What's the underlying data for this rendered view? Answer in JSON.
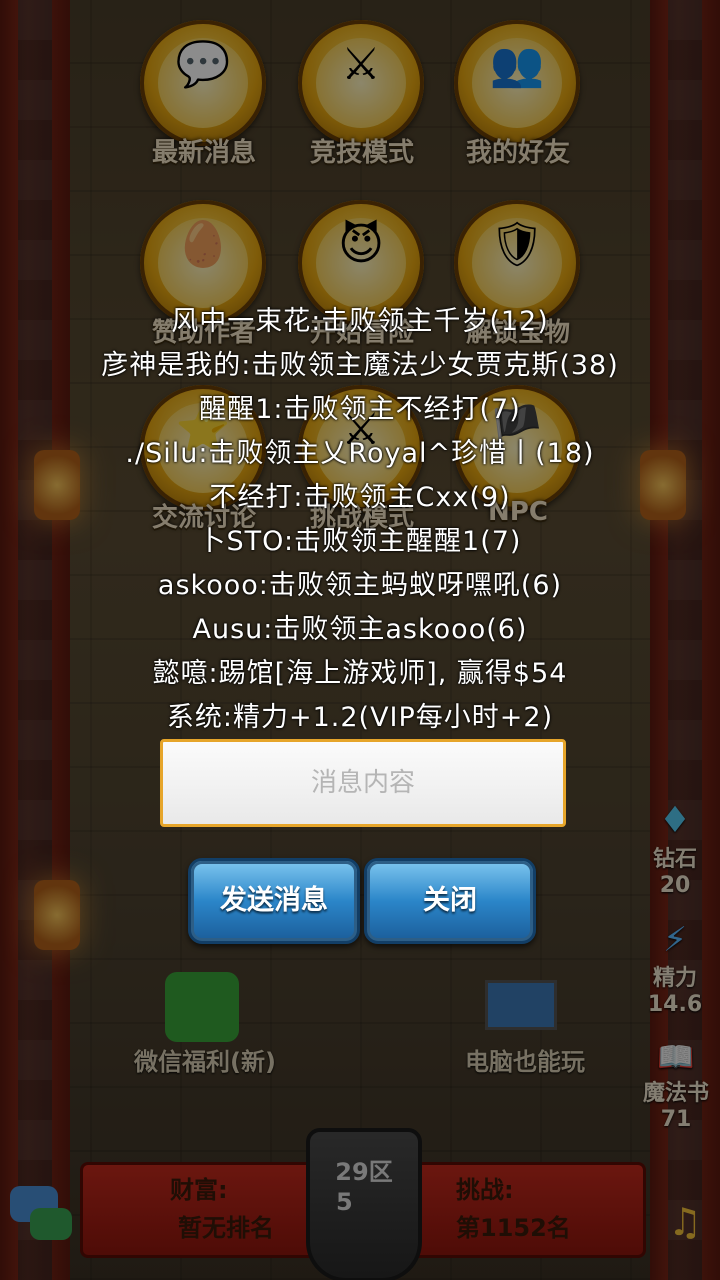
{
  "menu": [
    {
      "label": "最新消息",
      "icon": "message-book-icon",
      "glyph": "💬"
    },
    {
      "label": "竞技模式",
      "icon": "crossed-swords-vs-icon",
      "glyph": "⚔"
    },
    {
      "label": "我的好友",
      "icon": "friends-icon",
      "glyph": "👥"
    },
    {
      "label": "赞助作者",
      "icon": "egg-icon",
      "glyph": "🥚"
    },
    {
      "label": "开始冒险",
      "icon": "devil-icon",
      "glyph": "😈"
    },
    {
      "label": "解锁宝物",
      "icon": "armor-sword-icon",
      "glyph": "🛡"
    },
    {
      "label": "交流讨论",
      "icon": "discussion-shield-icon",
      "glyph": "⭐"
    },
    {
      "label": "挑战模式",
      "icon": "challenge-icon",
      "glyph": "⚔"
    },
    {
      "label": "NPC",
      "icon": "npc-icon",
      "glyph": "🏴"
    }
  ],
  "chat_lines": [
    "风中一束花:击败领主千岁(12)",
    "彦神是我的:击败领主魔法少女贾克斯(38)",
    "醒醒1:击败领主不经打(7)",
    "./Silu:击败领主乂Royal^珍惜丨(18)",
    "不经打:击败领主Cxx(9)",
    "卜STO:击败领主醒醒1(7)",
    "askooo:击败领主蚂蚁呀嘿吼(6)",
    "Ausu:击败领主askooo(6)",
    "懿噫:踢馆[海上游戏师], 赢得$54",
    "系统:精力+1.2(VIP每小时+2)"
  ],
  "message_input": {
    "placeholder": "消息内容",
    "value": ""
  },
  "buttons": {
    "send": "发送消息",
    "close": "关闭"
  },
  "bottom": {
    "wechat_label": "微信福利(新)",
    "pc_label": "电脑也能玩",
    "wealth_label": "财富:",
    "wealth_value": "暂无排名",
    "challenge_label": "挑战:",
    "challenge_value": "第1152名",
    "region": "29区",
    "level": "5"
  },
  "side_stats": {
    "diamond_label": "钻石",
    "diamond_value": "20",
    "energy_label": "精力",
    "energy_value": "14.6",
    "magic_label": "魔法书",
    "magic_value": "71"
  },
  "colors": {
    "accent_button": "#2b86c9",
    "input_border": "#e6a52a",
    "banner": "#c32a1d"
  }
}
